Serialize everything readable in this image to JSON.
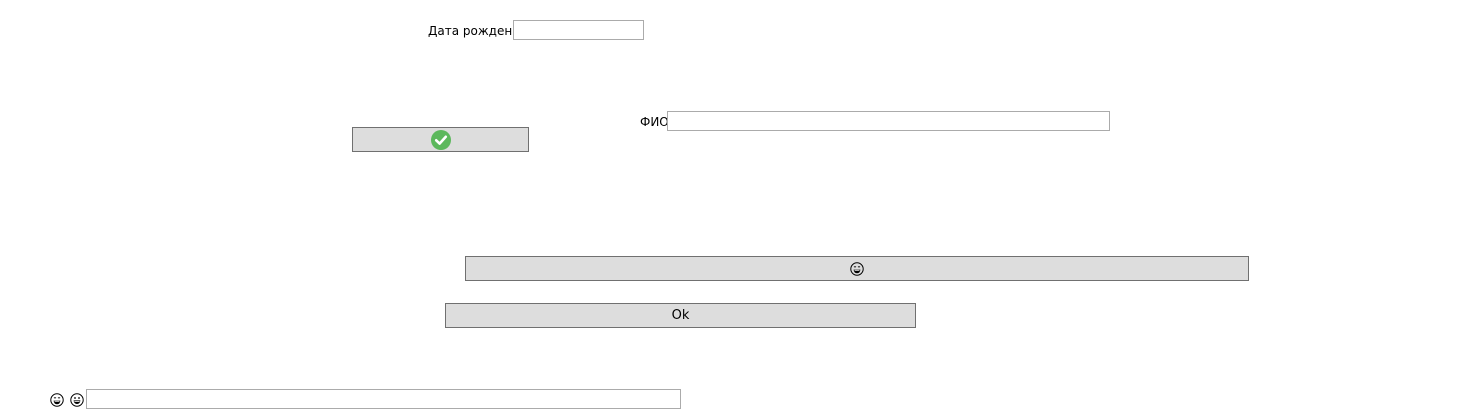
{
  "birth_date": {
    "label": "Дата рождения",
    "value": ""
  },
  "full_name": {
    "label": "ФИО",
    "value": ""
  },
  "buttons": {
    "confirm_icon": "check-circle-icon",
    "emoji_icon": "grinning-sweat-face-icon",
    "ok_label": "Ok"
  },
  "bottom_row": {
    "icons": [
      "grinning-sweat-face-icon",
      "grinning-face-icon"
    ],
    "input_value": ""
  },
  "colors": {
    "check_green": "#5cb85c",
    "button_bg": "#dddddd",
    "button_border": "#707070",
    "field_border": "#ababab"
  }
}
